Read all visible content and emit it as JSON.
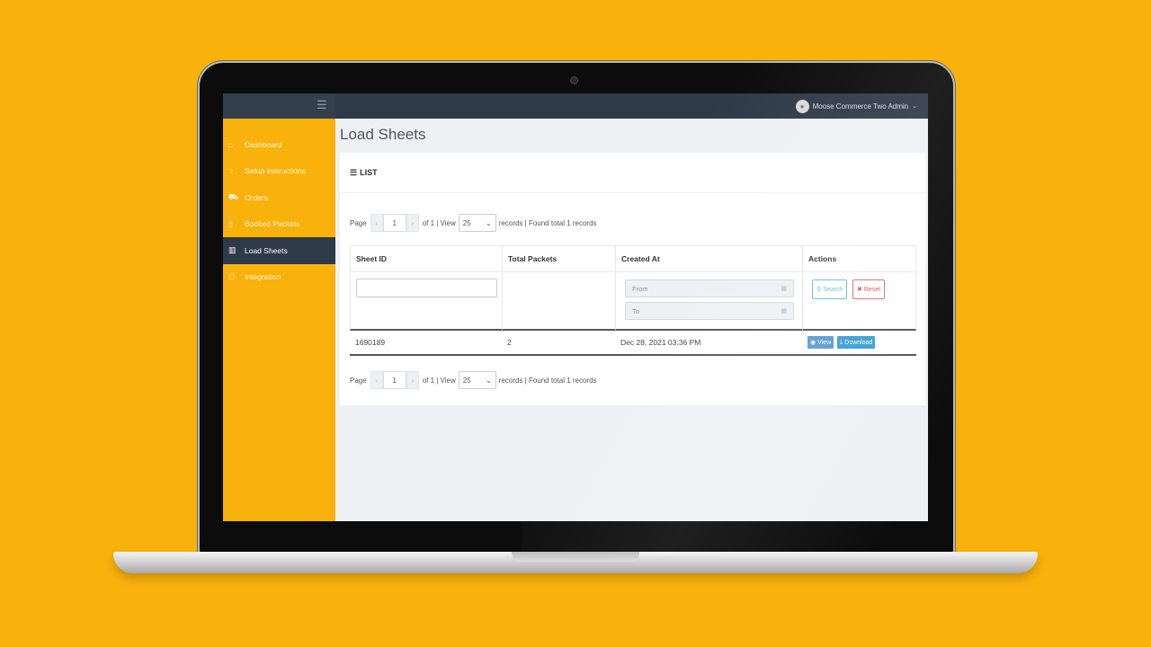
{
  "topbar": {
    "menu_icon": "hamburger-icon",
    "user_name": "Moose Commerce Two Admin"
  },
  "sidebar": {
    "items": [
      {
        "label": "Dashboard",
        "icon": "home-icon",
        "active": false
      },
      {
        "label": "Setup Instructions",
        "icon": "lightbulb-icon",
        "active": false
      },
      {
        "label": "Orders",
        "icon": "cart-icon",
        "active": false
      },
      {
        "label": "Booked Packets",
        "icon": "clipboard-icon",
        "active": false
      },
      {
        "label": "Load Sheets",
        "icon": "bar-chart-icon",
        "active": true
      },
      {
        "label": "Integration",
        "icon": "plug-icon",
        "active": false
      }
    ]
  },
  "main": {
    "title": "Load Sheets",
    "card_title": "LIST"
  },
  "pager": {
    "page_label": "Page",
    "prev": "‹",
    "next": "›",
    "page_value": "1",
    "of_text": "of 1 | View",
    "per_page": "25",
    "records_text": "records | Found total 1 records"
  },
  "table": {
    "columns": [
      "Sheet ID",
      "Total Packets",
      "Created At",
      "Actions"
    ],
    "filters": {
      "from_placeholder": "From",
      "to_placeholder": "To",
      "search_label": "Search",
      "reset_label": "Reset"
    },
    "rows": [
      {
        "sheet_id": "1690189",
        "total_packets": "2",
        "created_at": "Dec 28, 2021 03:36 PM",
        "view_label": "View",
        "download_label": "Download"
      }
    ]
  },
  "colors": {
    "background": "#F9B10B",
    "sidebar": "#F9B10B",
    "topbar": "#2f3a48",
    "active_item": "#2f3a48"
  }
}
